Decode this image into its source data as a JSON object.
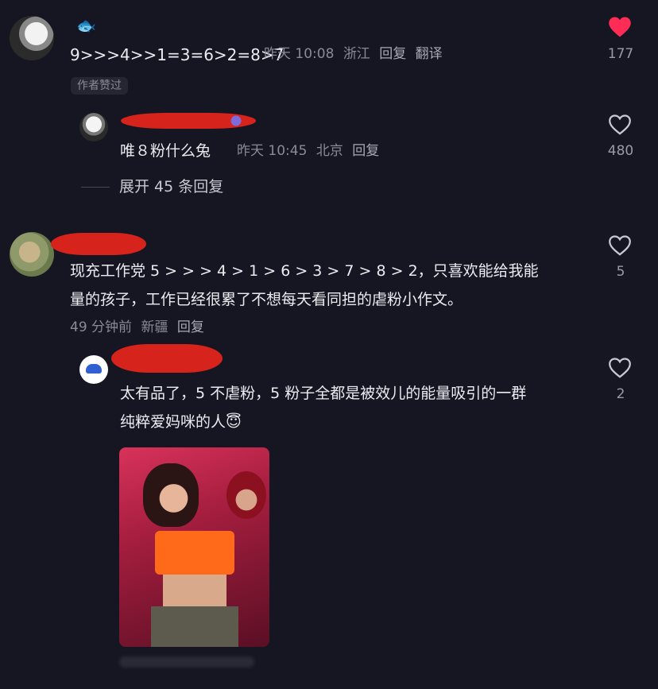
{
  "comments": [
    {
      "emoji": "🐟",
      "text": "9>>>4>>1=3=6>2=8>7",
      "time": "昨天 10:08",
      "location": "浙江",
      "reply_label": "回复",
      "translate_label": "翻译",
      "like_count": "177",
      "liked": true,
      "author_badge": "作者赞过",
      "replies": [
        {
          "text": "唯８粉什么兔",
          "time": "昨天 10:45",
          "location": "北京",
          "reply_label": "回复",
          "like_count": "480"
        }
      ],
      "expand_label": "展开 45 条回复"
    },
    {
      "text_line1": "现充工作党 5 > > > 4 > 1 > 6 > 3 > 7 > 8 > 2，只喜欢能给我能",
      "text_line2": "量的孩子，工作已经很累了不想每天看同担的虐粉小作文。",
      "time": "49 分钟前",
      "location": "新疆",
      "reply_label": "回复",
      "like_count": "5",
      "replies": [
        {
          "text_line1": "太有品了，5 不虐粉，5 粉子全都是被效儿的能量吸引的一群",
          "text_line2": "纯粹爱妈咪的人",
          "emoji": "😇",
          "like_count": "2"
        }
      ]
    }
  ],
  "colors": {
    "background": "#161622",
    "liked_heart": "#ff2d55",
    "redaction": "#d6231b"
  }
}
